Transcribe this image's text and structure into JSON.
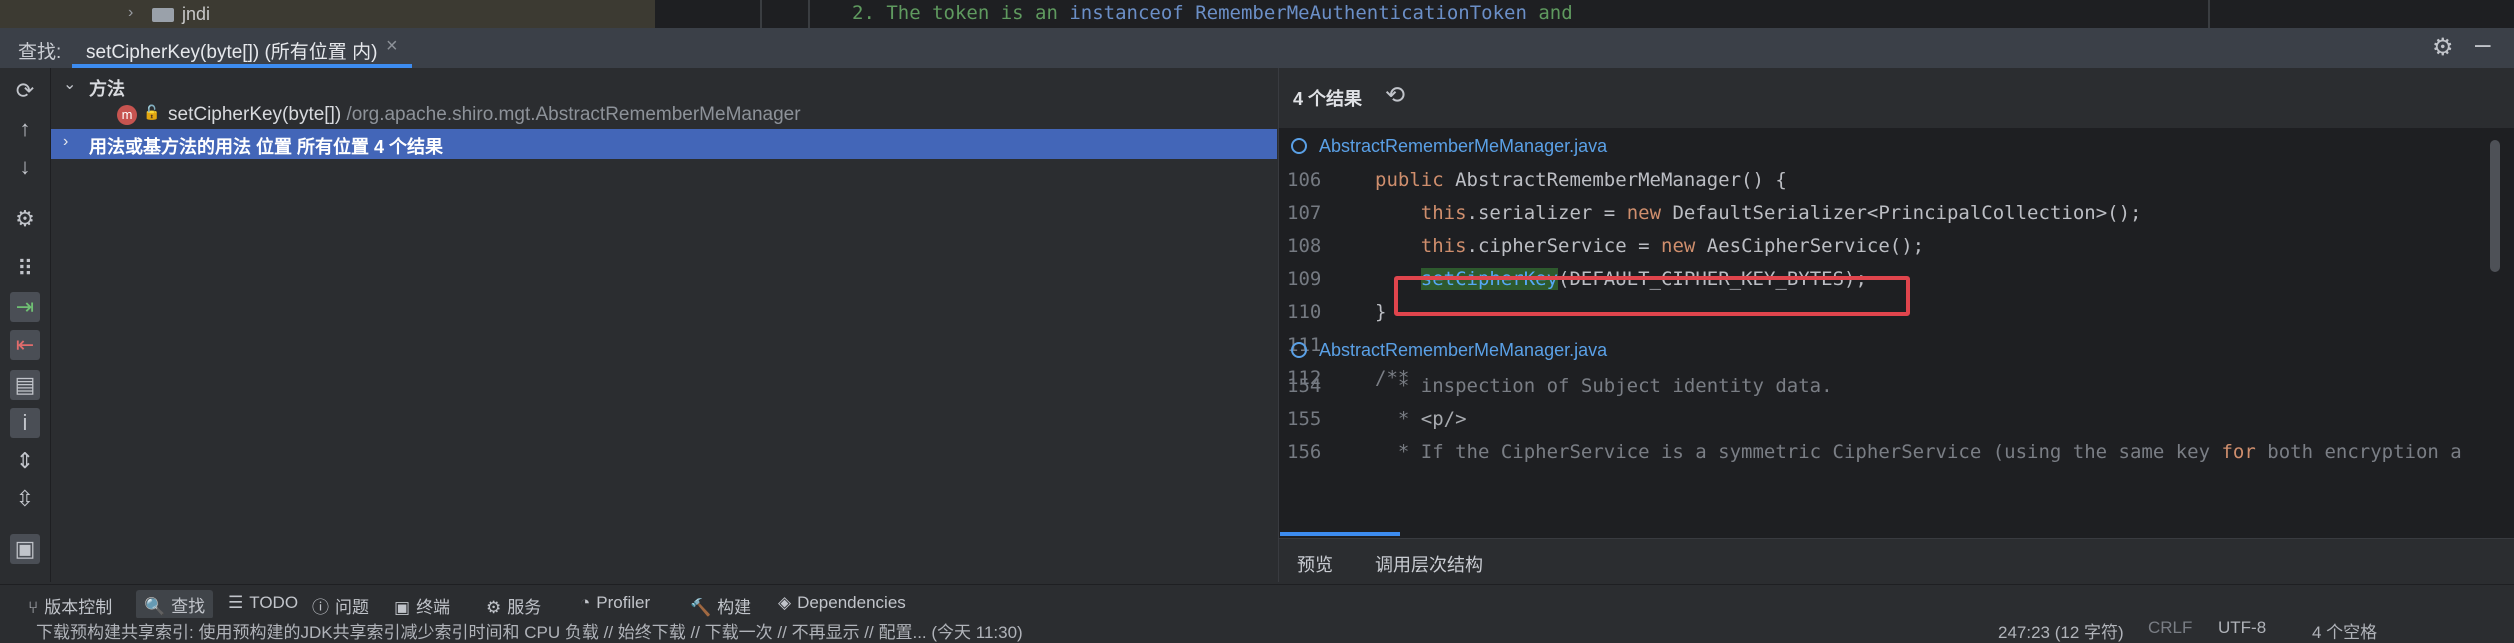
{
  "top_strip": {
    "project_folder": "jndi",
    "doc_prefix": "2. The token is an ",
    "doc_keyword": "instanceof",
    "doc_class": "RememberMeAuthenticationToken",
    "doc_suffix": " and"
  },
  "find_header": {
    "label": "查找:",
    "tab_title": "setCipherKey(byte[]) (所有位置 内)"
  },
  "tree": {
    "group_label": "方法",
    "item_name": "setCipherKey(byte[])",
    "item_path": " /org.apache.shiro.mgt.AbstractRememberMeManager",
    "selected_row": "用法或基方法的用法 位置 所有位置   4 个结果",
    "badge": "m"
  },
  "preview": {
    "result_count": "4 个结果",
    "file1": "AbstractRememberMeManager.java",
    "file2": "AbstractRememberMeManager.java",
    "block1": [
      {
        "n": "106",
        "parts": [
          [
            "kw",
            "public "
          ],
          [
            "",
            "AbstractRememberMeManager() {"
          ]
        ]
      },
      {
        "n": "107",
        "parts": [
          [
            "",
            "    "
          ],
          [
            "kw",
            "this"
          ],
          [
            "",
            ".serializer = "
          ],
          [
            "kw",
            "new "
          ],
          [
            "",
            "DefaultSerializer<PrincipalCollection>();"
          ]
        ]
      },
      {
        "n": "108",
        "parts": [
          [
            "",
            "    "
          ],
          [
            "kw",
            "this"
          ],
          [
            "",
            ".cipherService = "
          ],
          [
            "kw",
            "new "
          ],
          [
            "",
            "AesCipherService();"
          ]
        ]
      },
      {
        "n": "109",
        "parts": [
          [
            "",
            "    "
          ],
          [
            "hl",
            "setCipherKey"
          ],
          [
            "",
            "(DEFAULT_CIPHER_KEY_BYTES);"
          ]
        ]
      },
      {
        "n": "110",
        "parts": [
          [
            "",
            "}"
          ]
        ]
      },
      {
        "n": "111",
        "parts": [
          [
            "",
            ""
          ]
        ]
      },
      {
        "n": "112",
        "parts": [
          [
            "cm",
            "/**"
          ]
        ]
      }
    ],
    "block2": [
      {
        "n": "154",
        "parts": [
          [
            "cm",
            "  * inspection of Subject identity data."
          ]
        ]
      },
      {
        "n": "155",
        "parts": [
          [
            "cm",
            "  * "
          ],
          [
            "cmtag",
            "<p/>"
          ]
        ]
      },
      {
        "n": "156",
        "parts": [
          [
            "cm",
            "  * If the CipherService is a symmetric CipherService (using the same key "
          ],
          [
            "kw",
            "for"
          ],
          [
            "cm",
            " both encryption a"
          ]
        ]
      }
    ],
    "tabs": [
      "预览",
      "调用层次结构"
    ]
  },
  "tool_windows": [
    {
      "icon": "⑂",
      "label": "版本控制"
    },
    {
      "icon": "🔍",
      "label": "查找"
    },
    {
      "icon": "☰",
      "label": "TODO"
    },
    {
      "icon": "ⓘ",
      "label": "问题"
    },
    {
      "icon": "▣",
      "label": "终端"
    },
    {
      "icon": "⚙",
      "label": "服务"
    },
    {
      "icon": "◔",
      "label": "Profiler"
    },
    {
      "icon": "🔨",
      "label": "构建"
    },
    {
      "icon": "◈",
      "label": "Dependencies"
    }
  ],
  "status": {
    "message": "下载预构建共享索引: 使用预构建的JDK共享索引减少索引时间和 CPU 负载 // 始终下载 // 下载一次 // 不再显示 // 配置... (今天 11:30)",
    "position": "247:23 (12 字符)",
    "line_ending": "CRLF",
    "encoding": "UTF-8",
    "indent": "4 个空格"
  }
}
